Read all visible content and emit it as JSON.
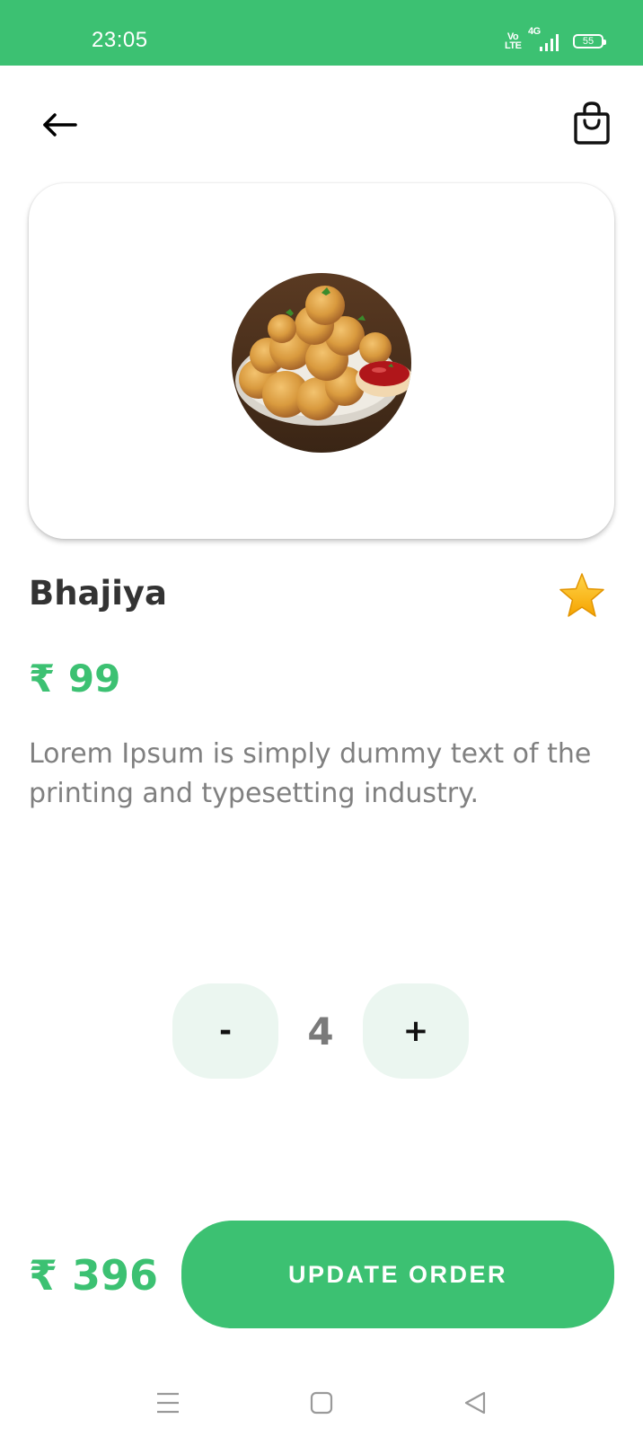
{
  "status_bar": {
    "time": "23:05",
    "volte_label": "Vo\nLTE",
    "network_label": "4G",
    "battery_level": "55",
    "background_color": "#3cc172"
  },
  "top_nav": {
    "back_icon": "arrow-left-icon",
    "cart_icon": "shopping-bag-icon"
  },
  "product": {
    "image_icon": "bhajiya-food-image",
    "name": "Bhajiya",
    "favorite_icon": "star-icon",
    "price": "₹ 99",
    "description": "Lorem Ipsum is simply dummy text of the printing and typesetting industry."
  },
  "quantity": {
    "decrement_label": "-",
    "value": "4",
    "increment_label": "+"
  },
  "order": {
    "total": "₹ 396",
    "update_button_label": "UPDATE ORDER",
    "accent_color": "#3cc172"
  },
  "system_nav": {
    "menu_icon": "menu-icon",
    "home_icon": "home-square-icon",
    "back_icon": "back-triangle-icon"
  }
}
